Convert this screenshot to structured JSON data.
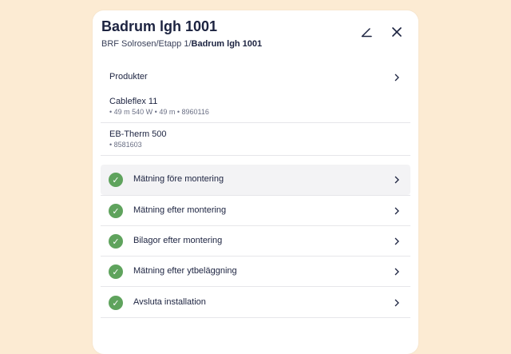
{
  "header": {
    "title": "Badrum lgh 1001",
    "breadcrumb": {
      "prefix": "BRF Solrosen/Etapp 1/",
      "current": "Badrum lgh 1001"
    },
    "edit_icon": "pencil-icon",
    "close_icon": "close-icon"
  },
  "products": {
    "label": "Produkter",
    "items": [
      {
        "name": "Cableflex 11",
        "meta": "• 49 m 540 W  • 49 m  • 8960116"
      },
      {
        "name": "EB-Therm 500",
        "meta": "• 8581603"
      }
    ]
  },
  "steps": [
    {
      "label": "Mätning före montering",
      "status": "done"
    },
    {
      "label": "Mätning efter montering",
      "status": "done"
    },
    {
      "label": "Bilagor efter montering",
      "status": "done"
    },
    {
      "label": "Mätning efter ytbeläggning",
      "status": "done"
    },
    {
      "label": "Avsluta installation",
      "status": "done"
    }
  ],
  "colors": {
    "background": "#fcebd3",
    "check": "#5fa35d",
    "text": "#1c2340"
  }
}
